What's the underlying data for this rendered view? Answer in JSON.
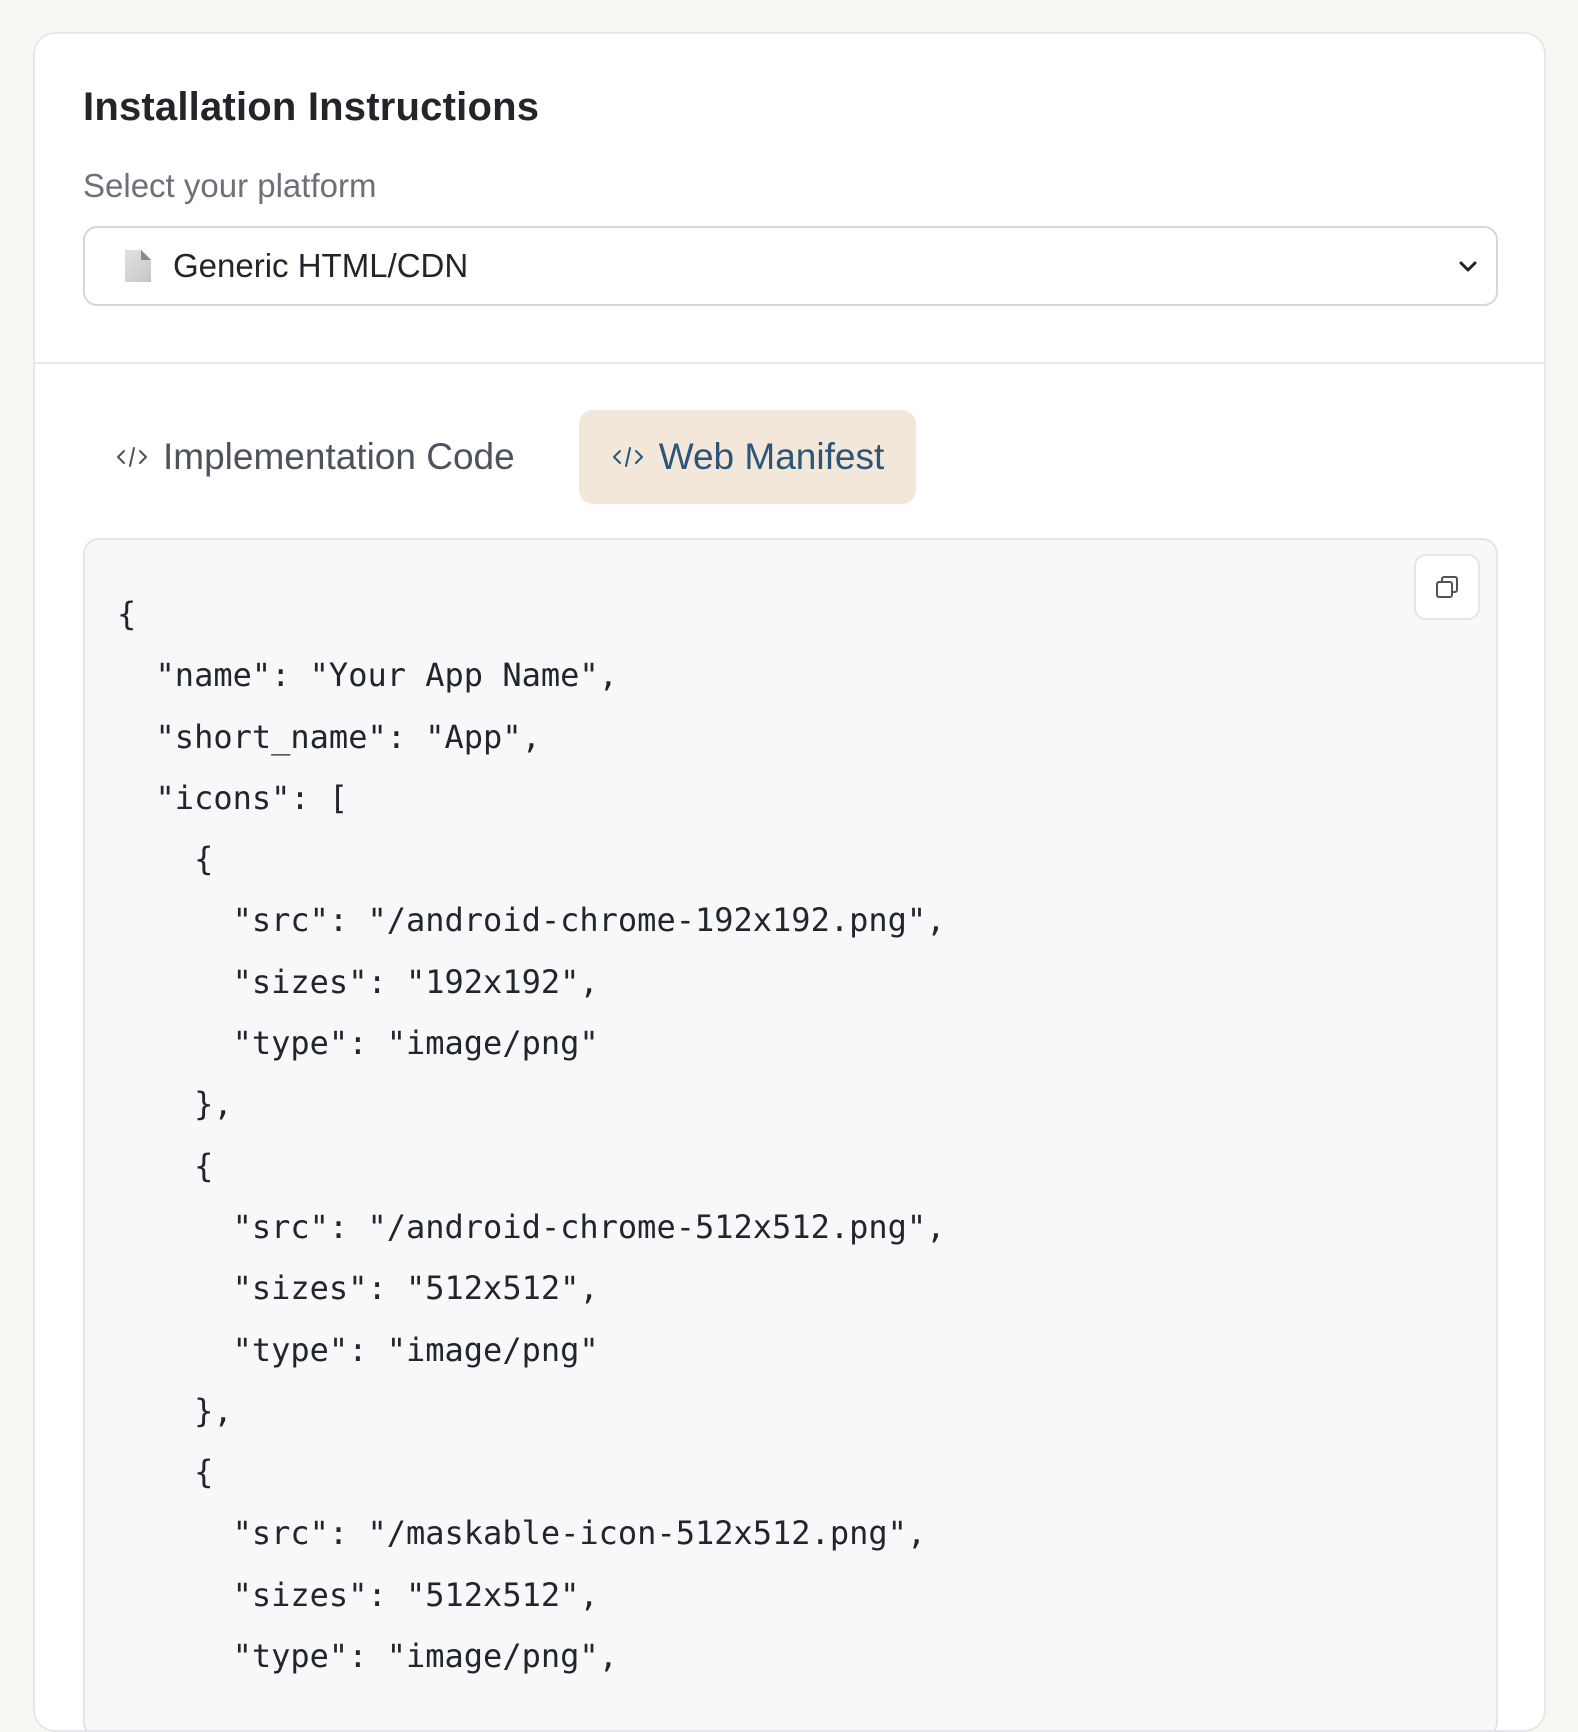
{
  "header": {
    "title": "Installation Instructions",
    "select_label": "Select your platform"
  },
  "platform_select": {
    "icon": "page-facing-up-icon",
    "selected": "Generic HTML/CDN"
  },
  "tabs": [
    {
      "label": "Implementation Code",
      "icon": "code-icon",
      "active": false
    },
    {
      "label": "Web Manifest",
      "icon": "code-icon",
      "active": true
    }
  ],
  "code": {
    "lines": [
      "{",
      "  \"name\": \"Your App Name\",",
      "  \"short_name\": \"App\",",
      "  \"icons\": [",
      "    {",
      "      \"src\": \"/android-chrome-192x192.png\",",
      "      \"sizes\": \"192x192\",",
      "      \"type\": \"image/png\"",
      "    },",
      "    {",
      "      \"src\": \"/android-chrome-512x512.png\",",
      "      \"sizes\": \"512x512\",",
      "      \"type\": \"image/png\"",
      "    },",
      "    {",
      "      \"src\": \"/maskable-icon-512x512.png\",",
      "      \"sizes\": \"512x512\",",
      "      \"type\": \"image/png\","
    ],
    "copy_icon": "copy-icon"
  },
  "colors": {
    "page_bg": "#f8f8f3",
    "active_tab_bg": "#f2e7d8",
    "active_tab_text": "#2c5679",
    "code_bg": "#f7f8fa"
  }
}
